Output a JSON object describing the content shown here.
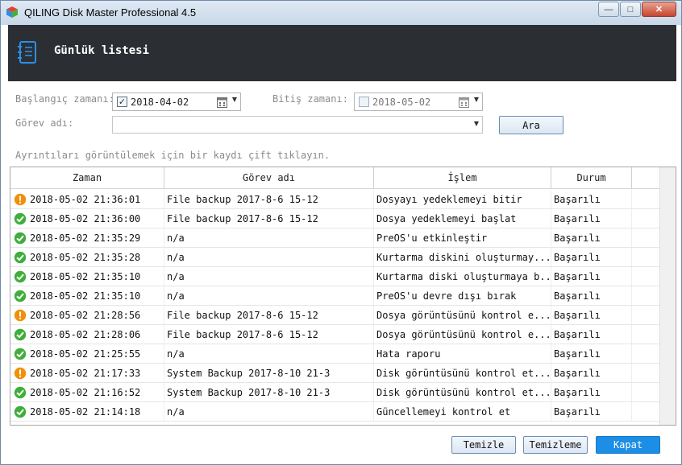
{
  "window": {
    "title": "QILING Disk Master Professional 4.5",
    "minimize": "—",
    "maximize": "□",
    "close": "✕"
  },
  "header": {
    "title": "Günlük listesi",
    "icon": "log-list-icon"
  },
  "filters": {
    "start_label": "Başlangıç zamanı:",
    "start_checked": true,
    "start_date": "2018-04-02",
    "end_label": "Bitiş zamanı:",
    "end_checked": false,
    "end_date": "2018-05-02",
    "task_label": "Görev adı:",
    "task_value": "",
    "search_button": "Ara"
  },
  "hint": "Ayrıntıları görüntülemek için bir kaydı çift tıklayın.",
  "table": {
    "columns": [
      "Zaman",
      "Görev adı",
      "İşlem",
      "Durum"
    ],
    "rows": [
      {
        "status_icon": "warning",
        "time": "2018-05-02 21:36:01",
        "task": "File backup 2017-8-6 15-12",
        "operation": "Dosyayı yedeklemeyi bitir",
        "state": "Başarılı"
      },
      {
        "status_icon": "success",
        "time": "2018-05-02 21:36:00",
        "task": "File backup 2017-8-6 15-12",
        "operation": "Dosya yedeklemeyi başlat",
        "state": "Başarılı"
      },
      {
        "status_icon": "success",
        "time": "2018-05-02 21:35:29",
        "task": "n/a",
        "operation": "PreOS'u etkinleştir",
        "state": "Başarılı"
      },
      {
        "status_icon": "success",
        "time": "2018-05-02 21:35:28",
        "task": "n/a",
        "operation": "Kurtarma diskini oluşturmay...",
        "state": "Başarılı"
      },
      {
        "status_icon": "success",
        "time": "2018-05-02 21:35:10",
        "task": "n/a",
        "operation": "Kurtarma diski oluşturmaya b...",
        "state": "Başarılı"
      },
      {
        "status_icon": "success",
        "time": "2018-05-02 21:35:10",
        "task": "n/a",
        "operation": "PreOS'u devre dışı bırak",
        "state": "Başarılı"
      },
      {
        "status_icon": "warning",
        "time": "2018-05-02 21:28:56",
        "task": "File backup 2017-8-6 15-12",
        "operation": "Dosya görüntüsünü kontrol e...",
        "state": "Başarılı"
      },
      {
        "status_icon": "success",
        "time": "2018-05-02 21:28:06",
        "task": "File backup 2017-8-6 15-12",
        "operation": "Dosya görüntüsünü kontrol e...",
        "state": "Başarılı"
      },
      {
        "status_icon": "success",
        "time": "2018-05-02 21:25:55",
        "task": "n/a",
        "operation": "Hata raporu",
        "state": "Başarılı"
      },
      {
        "status_icon": "warning",
        "time": "2018-05-02 21:17:33",
        "task": "System Backup 2017-8-10 21-3",
        "operation": "Disk görüntüsünü kontrol et...",
        "state": "Başarılı"
      },
      {
        "status_icon": "success",
        "time": "2018-05-02 21:16:52",
        "task": "System Backup 2017-8-10 21-3",
        "operation": "Disk görüntüsünü kontrol et...",
        "state": "Başarılı"
      },
      {
        "status_icon": "success",
        "time": "2018-05-02 21:14:18",
        "task": "n/a",
        "operation": "Güncellemeyi kontrol et",
        "state": "Başarılı"
      }
    ]
  },
  "buttons": {
    "clear": "Temizle",
    "clear_all": "Temizleme",
    "close": "Kapat"
  },
  "colors": {
    "header_bg": "#2b2f34",
    "accent": "#1c8ee6",
    "success": "#3fae3a",
    "warning": "#f0900a"
  }
}
